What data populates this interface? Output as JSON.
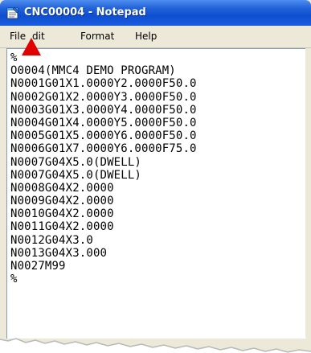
{
  "window": {
    "title": "CNC00004 - Notepad",
    "icon": "notepad-icon"
  },
  "menu": {
    "items": [
      {
        "label": "File"
      },
      {
        "label": "dit"
      },
      {
        "label": "Format"
      },
      {
        "label": "Help"
      }
    ]
  },
  "editor": {
    "lines": [
      "%",
      "O0004(MMC4 DEMO PROGRAM)",
      "N0001G01X1.0000Y2.0000F50.0",
      "N0002G01X2.0000Y3.0000F50.0",
      "N0003G01X3.0000Y4.0000F50.0",
      "N0004G01X4.0000Y5.0000F50.0",
      "N0005G01X5.0000Y6.0000F50.0",
      "N0006G01X7.0000Y6.0000F75.0",
      "N0007G04X5.0(DWELL)",
      "N0007G04X5.0(DWELL)",
      "N0008G04X2.0000",
      "N0009G04X2.0000",
      "N0010G04X2.0000",
      "N0011G04X2.0000",
      "N0012G04X3.0",
      "N0013G04X3.000",
      "N0027M99",
      "%"
    ]
  },
  "annotation": {
    "icon": "red-arrow-up-icon",
    "color": "#e00000"
  },
  "colors": {
    "titlebar": "#0e4fd0",
    "menubar": "#ece9d8",
    "editor_bg": "#ffffff"
  }
}
